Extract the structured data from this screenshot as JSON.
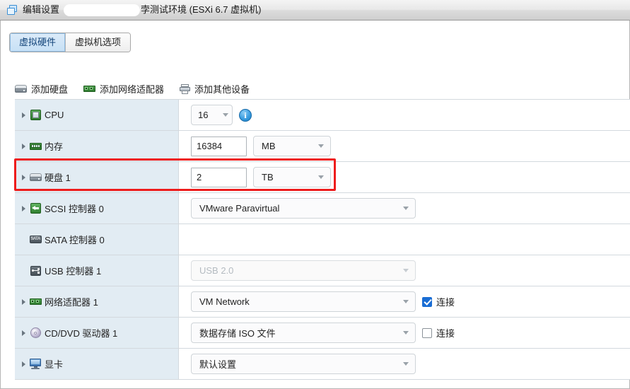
{
  "window": {
    "icon": "vm-windows-icon",
    "title_prefix": "编辑设置",
    "redacted": "",
    "title_suffix": "孛测试环境 (ESXi 6.7 虚拟机)"
  },
  "tabs": [
    {
      "label": "虚拟硬件",
      "active": true
    },
    {
      "label": "虚拟机选项",
      "active": false
    }
  ],
  "toolbar": [
    {
      "label": "添加硬盘",
      "icon": "hard-disk-icon"
    },
    {
      "label": "添加网络适配器",
      "icon": "network-adapter-icon"
    },
    {
      "label": "添加其他设备",
      "icon": "other-device-icon"
    }
  ],
  "devices": [
    {
      "name": "CPU",
      "icon": "cpu-icon",
      "expandable": true,
      "control": "select-small",
      "value": "16",
      "info": "i"
    },
    {
      "name": "内存",
      "icon": "memory-icon",
      "expandable": true,
      "control": "text-unit",
      "value": "16384",
      "unit": "MB"
    },
    {
      "name": "硬盘 1",
      "icon": "hard-disk-icon",
      "expandable": true,
      "control": "text-unit",
      "value": "2",
      "unit": "TB",
      "highlighted": true
    },
    {
      "name": "SCSI 控制器 0",
      "icon": "scsi-controller-icon",
      "expandable": true,
      "control": "select-large",
      "value": "VMware Paravirtual"
    },
    {
      "name": "SATA 控制器 0",
      "icon": "sata-controller-icon",
      "expandable": false,
      "control": "none",
      "value": ""
    },
    {
      "name": "USB 控制器 1",
      "icon": "usb-controller-icon",
      "expandable": false,
      "control": "select-large-disabled",
      "value": "USB 2.0"
    },
    {
      "name": "网络适配器 1",
      "icon": "network-adapter-icon",
      "expandable": true,
      "control": "select-large",
      "value": "VM Network",
      "checkbox": {
        "label": "连接",
        "checked": true
      }
    },
    {
      "name": "CD/DVD 驱动器 1",
      "icon": "cddvd-drive-icon",
      "expandable": true,
      "control": "select-large",
      "value": "数据存储 ISO 文件",
      "checkbox": {
        "label": "连接",
        "checked": false
      }
    },
    {
      "name": "显卡",
      "icon": "video-card-icon",
      "expandable": true,
      "control": "select-large",
      "value": "默认设置"
    }
  ],
  "colors": {
    "accent_blue": "#1a6dd4",
    "label_column_bg": "#e2ecf3",
    "annotation_red": "#ee1c1c",
    "active_tab_text": "#12447a"
  },
  "annotation": {
    "type": "highlight-rectangle",
    "target": "硬盘 1"
  }
}
